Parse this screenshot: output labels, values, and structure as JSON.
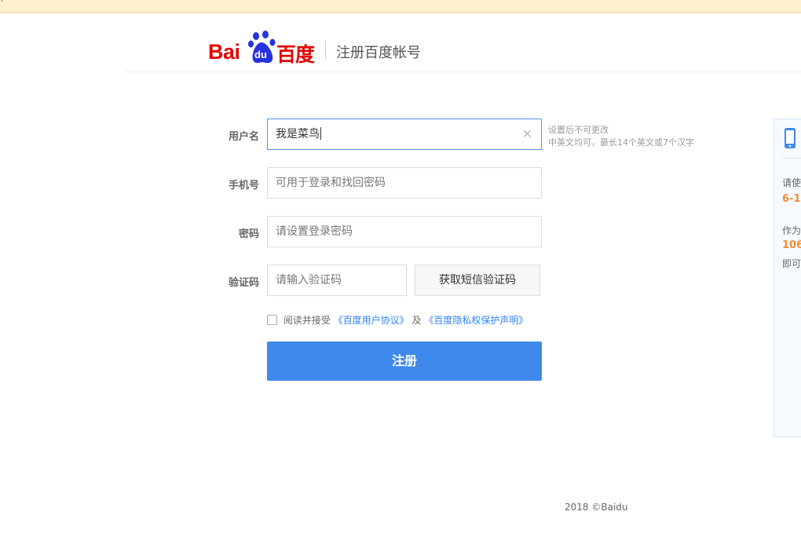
{
  "top_bar": {
    "mark": "'"
  },
  "header": {
    "logo_latin": "Bai",
    "logo_du": "du",
    "logo_cn": "百度",
    "title": "注册百度帐号"
  },
  "form": {
    "username": {
      "label": "用户名",
      "value": "我是菜鸟",
      "clear_icon": "close-icon",
      "hint_line1": "设置后不可更改",
      "hint_line2": "中英文均可，最长14个英文或7个汉字"
    },
    "phone": {
      "label": "手机号",
      "placeholder": "可用于登录和找回密码"
    },
    "password": {
      "label": "密码",
      "placeholder": "请设置登录密码"
    },
    "verify_code": {
      "label": "验证码",
      "placeholder": "请输入验证码",
      "sms_button": "获取短信验证码"
    },
    "agreement": {
      "prefix": "阅读并接受",
      "user_agreement": "《百度用户协议》",
      "connector": "及",
      "privacy_statement": "《百度隐私权保护声明》",
      "checked": false
    },
    "submit_label": "注册"
  },
  "side_panel": {
    "icon": "phone-icon",
    "line1": "请使",
    "line2": "6-1",
    "line3": "作为",
    "line4": "106",
    "line5": "即可"
  },
  "footer": {
    "copyright": "2018 ©Baidu"
  },
  "colors": {
    "brand_red": "#e10602",
    "brand_blue": "#2932e1",
    "button_blue": "#3f89ec",
    "link_blue": "#2e82ff",
    "focus_border": "#4791ff",
    "accent_orange": "#f38b32",
    "top_strip": "#fdf0cd"
  }
}
